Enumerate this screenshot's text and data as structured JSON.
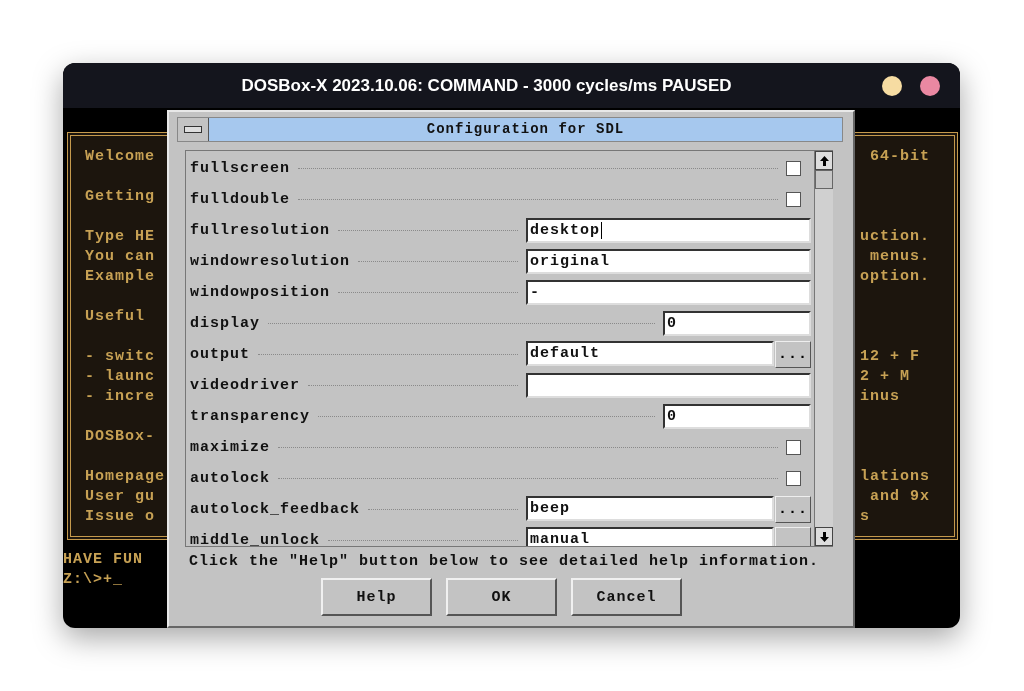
{
  "window": {
    "title": "DOSBox-X 2023.10.06: COMMAND - 3000 cycles/ms PAUSED",
    "controls": [
      {
        "color": "#f6dca2"
      },
      {
        "color": "#ea88a2"
      }
    ]
  },
  "console": {
    "panel": [
      {
        "left": [
          "Welcome"
        ],
        "right": [
          " 64-bit"
        ]
      },
      {
        "left": [
          "Getting"
        ]
      },
      {
        "left": [
          "Type HE",
          "You can",
          "Example"
        ],
        "right": [
          "uction.",
          " menus.",
          "option."
        ]
      },
      {
        "left": [
          "Useful"
        ]
      },
      {
        "left": [
          "- switc",
          "- launc",
          "- incre"
        ],
        "right": [
          "12 + F",
          "2 + M",
          "inus"
        ]
      },
      {
        "left": [
          "DOSBox-"
        ]
      },
      {
        "left": [
          "Homepage",
          "User gu",
          "Issue o"
        ],
        "right": [
          "lations",
          " and 9x",
          "s"
        ]
      }
    ],
    "prompt": [
      "HAVE FUN",
      "Z:\\>+_"
    ]
  },
  "dialog": {
    "title": "Configuration for SDL",
    "settings": [
      {
        "kind": "checkbox",
        "label": "fullscreen",
        "checked": false
      },
      {
        "kind": "checkbox",
        "label": "fulldouble",
        "checked": false
      },
      {
        "kind": "text",
        "label": "fullresolution",
        "value": "desktop",
        "focused": true
      },
      {
        "kind": "text",
        "label": "windowresolution",
        "value": "original",
        "focused": false
      },
      {
        "kind": "text",
        "label": "windowposition",
        "value": "-",
        "focused": false
      },
      {
        "kind": "number",
        "label": "display",
        "value": "0",
        "focused": false
      },
      {
        "kind": "choice",
        "label": "output",
        "value": "default",
        "button": "...",
        "focused": false
      },
      {
        "kind": "text",
        "label": "videodriver",
        "focused": false
      },
      {
        "kind": "number",
        "label": "transparency",
        "value": "0",
        "focused": false
      },
      {
        "kind": "checkbox",
        "label": "maximize",
        "checked": false
      },
      {
        "kind": "checkbox",
        "label": "autolock",
        "checked": false
      },
      {
        "kind": "choice",
        "label": "autolock_feedback",
        "value": "beep",
        "button": "...",
        "focused": false
      },
      {
        "kind": "choice",
        "label": "middle_unlock",
        "value": "manual",
        "focused": false
      }
    ],
    "hint": "Click the \"Help\" button below to see detailed help information.",
    "buttons": [
      "Help",
      "OK",
      "Cancel"
    ]
  }
}
